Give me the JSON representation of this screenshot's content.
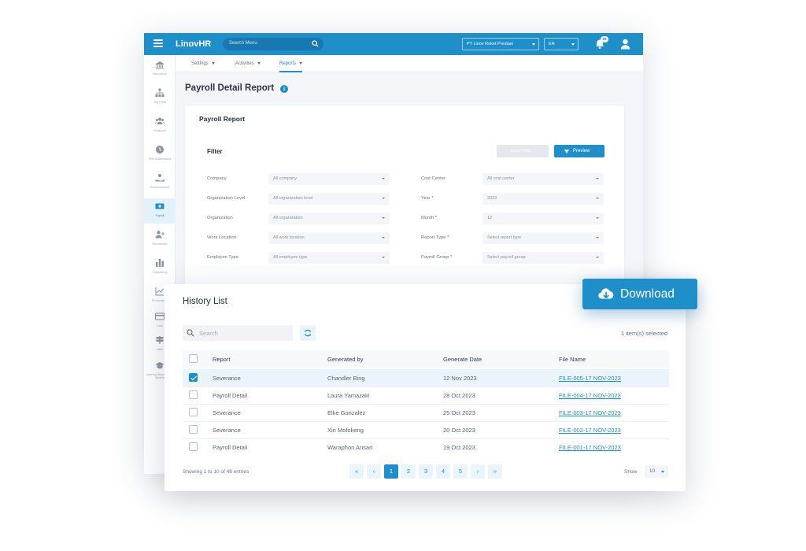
{
  "app": {
    "logo": "LinovHR",
    "search_placeholder": "Search Menu",
    "company": "PT Linov Roket Prestasi",
    "language": "EN",
    "notification_count": "99",
    "sidebar": [
      "Attendance",
      "Org Chart",
      "Employee",
      "Time & Attendance",
      "Reimbursement",
      "Payroll",
      "Recruitment",
      "Competency",
      "Performance",
      "Loan",
      "Letter",
      "Learning Management System"
    ],
    "tabs": [
      "Settings",
      "Activities",
      "Reports"
    ],
    "page_title": "Payroll Detail Report",
    "card_title": "Payroll Report",
    "filter": {
      "title": "Filter",
      "reset_label": "Reset Filter",
      "preview_label": "Preview",
      "left": [
        {
          "label": "Company",
          "value": "All company"
        },
        {
          "label": "Organization Level",
          "value": "All organization level"
        },
        {
          "label": "Organization",
          "value": "All organization"
        },
        {
          "label": "Work Location",
          "value": "All work location"
        },
        {
          "label": "Employee Type",
          "value": "All employee type"
        }
      ],
      "right": [
        {
          "label": "Cost Center",
          "value": "All cost center"
        },
        {
          "label": "Year *",
          "value": "2023"
        },
        {
          "label": "Month *",
          "value": "12"
        },
        {
          "label": "Report Type *",
          "value": "Select report type"
        },
        {
          "label": "Payroll Group *",
          "value": "Select payroll group"
        }
      ]
    }
  },
  "history": {
    "title": "History List",
    "search_placeholder": "Search",
    "selected_count": "1 item(s) selected",
    "columns": [
      "Report",
      "Generated by",
      "Generate Date",
      "File Name"
    ],
    "rows": [
      {
        "report": "Severance",
        "by": "Chandler Bing",
        "date": "12 Nov 2023",
        "file": "FILE-005-17 NOV-2023",
        "checked": true
      },
      {
        "report": "Payroll Detail",
        "by": "Laura Yamazaki",
        "date": "28 Oct 2023",
        "file": "FILE-004-17 NOV-2023",
        "checked": false
      },
      {
        "report": "Severance",
        "by": "Elke Gonzalez",
        "date": "25 Oct 2023",
        "file": "FILE-003-17 NOV-2023",
        "checked": false
      },
      {
        "report": "Severance",
        "by": "Xin Mofokeng",
        "date": "20 Oct 2023",
        "file": "FILE-002-17 NOV-2023",
        "checked": false
      },
      {
        "report": "Payroll Detail",
        "by": "Waraphon Ansari",
        "date": "19 Oct 2023",
        "file": "FILE-001-17 NOV-2023",
        "checked": false
      }
    ],
    "showing": "Showing 1 to 10 of 48 entries",
    "pages": [
      "1",
      "2",
      "3",
      "4",
      "5"
    ],
    "current_page": "1",
    "show_label": "Show",
    "page_size": "10"
  },
  "download_label": "Download",
  "colors": {
    "primary": "#1f8fc9",
    "topbar": "#1f8fc9"
  }
}
